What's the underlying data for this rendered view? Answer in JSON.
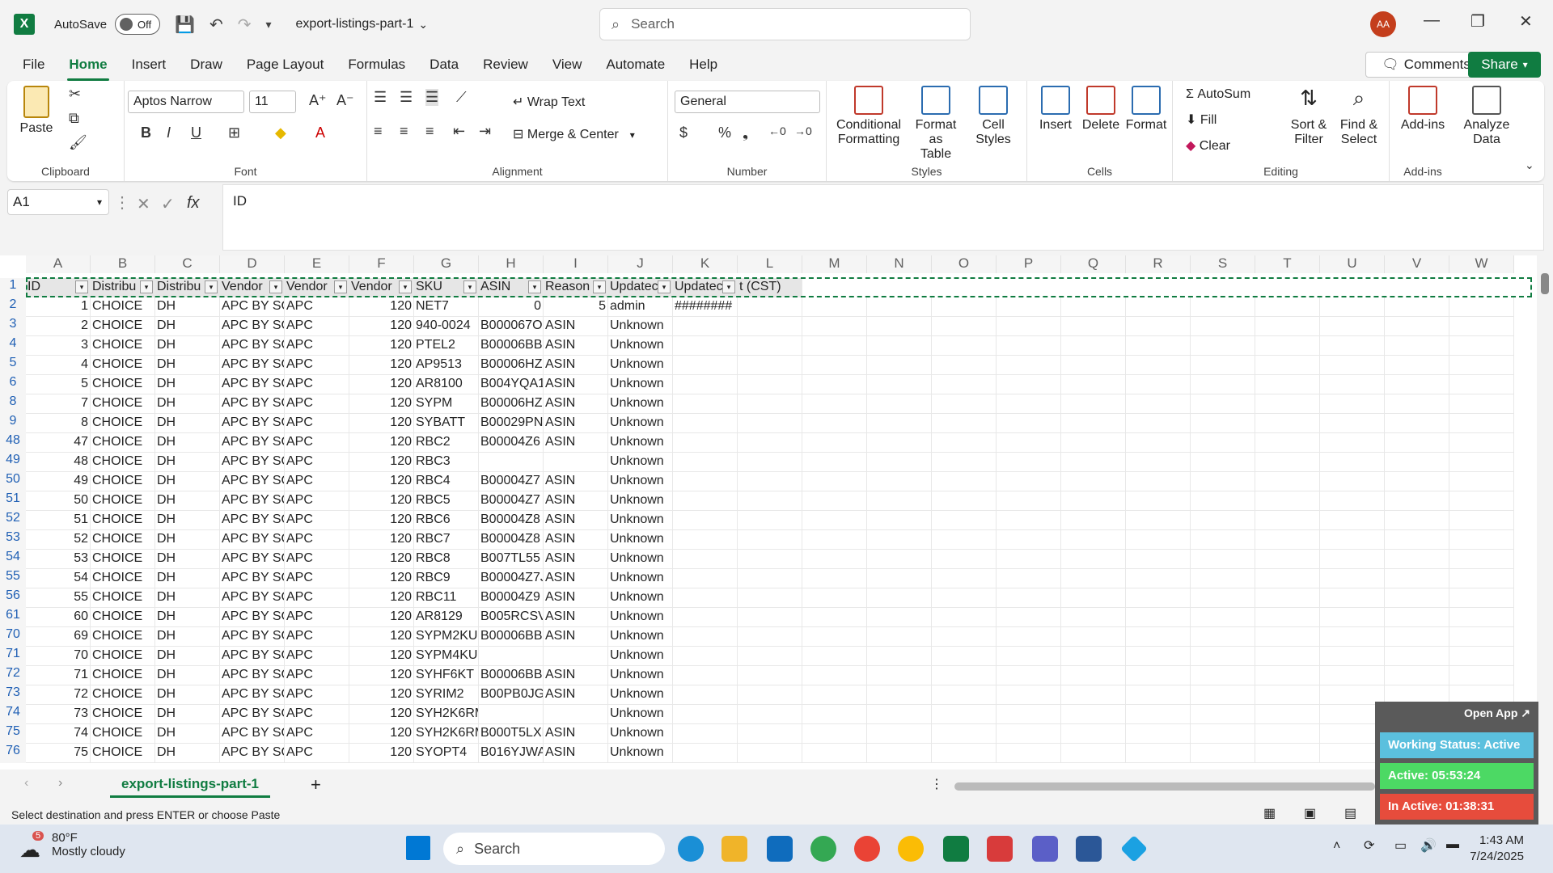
{
  "titlebar": {
    "app_logo": "X",
    "autosave_label": "AutoSave",
    "autosave_state": "Off",
    "doc_title": "export-listings-part-1",
    "search_placeholder": "Search",
    "avatar_initials": "AA"
  },
  "menu": {
    "items": [
      "File",
      "Home",
      "Insert",
      "Draw",
      "Page Layout",
      "Formulas",
      "Data",
      "Review",
      "View",
      "Automate",
      "Help"
    ],
    "active": "Home",
    "comments": "Comments",
    "share": "Share"
  },
  "ribbon": {
    "clipboard": {
      "label": "Clipboard",
      "paste": "Paste"
    },
    "font": {
      "label": "Font",
      "font_name": "Aptos Narrow",
      "font_size": "11"
    },
    "alignment": {
      "label": "Alignment",
      "wrap": "Wrap Text",
      "merge": "Merge & Center"
    },
    "number": {
      "label": "Number",
      "format": "General"
    },
    "styles": {
      "label": "Styles",
      "conditional": "Conditional",
      "conditional2": "Formatting",
      "format_table": "Format as",
      "format_table2": "Table",
      "cell_styles": "Cell",
      "cell_styles2": "Styles"
    },
    "cells": {
      "label": "Cells",
      "insert": "Insert",
      "delete": "Delete",
      "format": "Format"
    },
    "editing": {
      "label": "Editing",
      "autosum": "AutoSum",
      "fill": "Fill",
      "clear": "Clear",
      "sort": "Sort &",
      "sort2": "Filter",
      "find": "Find &",
      "find2": "Select"
    },
    "addins": {
      "label": "Add-ins",
      "addins": "Add-ins",
      "analyze": "Analyze",
      "analyze2": "Data"
    }
  },
  "formula_bar": {
    "namebox": "A1",
    "value": "ID"
  },
  "grid": {
    "columns": [
      "A",
      "B",
      "C",
      "D",
      "E",
      "F",
      "G",
      "H",
      "I",
      "J",
      "K",
      "L",
      "M",
      "N",
      "O",
      "P",
      "Q",
      "R",
      "S",
      "T",
      "U",
      "V",
      "W"
    ],
    "header_row": [
      "ID",
      "Distribu",
      "Distribu",
      "Vendor",
      "Vendor",
      "Vendor",
      "SKU",
      "ASIN",
      "Reason",
      "Updatec",
      "Updatec",
      "t (CST)"
    ],
    "rows": [
      {
        "n": "2",
        "c": [
          "1",
          "CHOICE",
          "DH",
          "APC BY SC",
          "APC",
          "120",
          "NET7",
          "0",
          "5",
          "admin",
          "########"
        ]
      },
      {
        "n": "3",
        "c": [
          "2",
          "CHOICE",
          "DH",
          "APC BY SC",
          "APC",
          "120",
          "940-0024",
          "B000067O",
          "ASIN",
          "Unknown",
          ""
        ]
      },
      {
        "n": "4",
        "c": [
          "3",
          "CHOICE",
          "DH",
          "APC BY SC",
          "APC",
          "120",
          "PTEL2",
          "B00006BB",
          "ASIN",
          "Unknown",
          ""
        ]
      },
      {
        "n": "5",
        "c": [
          "4",
          "CHOICE",
          "DH",
          "APC BY SC",
          "APC",
          "120",
          "AP9513",
          "B00006HZ",
          "ASIN",
          "Unknown",
          ""
        ]
      },
      {
        "n": "6",
        "c": [
          "5",
          "CHOICE",
          "DH",
          "APC BY SC",
          "APC",
          "120",
          "AR8100",
          "B004YQA1",
          "ASIN",
          "Unknown",
          ""
        ]
      },
      {
        "n": "8",
        "c": [
          "7",
          "CHOICE",
          "DH",
          "APC BY SC",
          "APC",
          "120",
          "SYPM",
          "B00006HZ",
          "ASIN",
          "Unknown",
          ""
        ]
      },
      {
        "n": "9",
        "c": [
          "8",
          "CHOICE",
          "DH",
          "APC BY SC",
          "APC",
          "120",
          "SYBATT",
          "B00029PN",
          "ASIN",
          "Unknown",
          ""
        ]
      },
      {
        "n": "48",
        "c": [
          "47",
          "CHOICE",
          "DH",
          "APC BY SC",
          "APC",
          "120",
          "RBC2",
          "B00004Z6",
          "ASIN",
          "Unknown",
          ""
        ]
      },
      {
        "n": "49",
        "c": [
          "48",
          "CHOICE",
          "DH",
          "APC BY SC",
          "APC",
          "120",
          "RBC3",
          "",
          "",
          "Unknown",
          ""
        ]
      },
      {
        "n": "50",
        "c": [
          "49",
          "CHOICE",
          "DH",
          "APC BY SC",
          "APC",
          "120",
          "RBC4",
          "B00004Z7",
          "ASIN",
          "Unknown",
          ""
        ]
      },
      {
        "n": "51",
        "c": [
          "50",
          "CHOICE",
          "DH",
          "APC BY SC",
          "APC",
          "120",
          "RBC5",
          "B00004Z7",
          "ASIN",
          "Unknown",
          ""
        ]
      },
      {
        "n": "52",
        "c": [
          "51",
          "CHOICE",
          "DH",
          "APC BY SC",
          "APC",
          "120",
          "RBC6",
          "B00004Z8",
          "ASIN",
          "Unknown",
          ""
        ]
      },
      {
        "n": "53",
        "c": [
          "52",
          "CHOICE",
          "DH",
          "APC BY SC",
          "APC",
          "120",
          "RBC7",
          "B00004Z8",
          "ASIN",
          "Unknown",
          ""
        ]
      },
      {
        "n": "54",
        "c": [
          "53",
          "CHOICE",
          "DH",
          "APC BY SC",
          "APC",
          "120",
          "RBC8",
          "B007TL55",
          "ASIN",
          "Unknown",
          ""
        ]
      },
      {
        "n": "55",
        "c": [
          "54",
          "CHOICE",
          "DH",
          "APC BY SC",
          "APC",
          "120",
          "RBC9",
          "B00004Z7J",
          "ASIN",
          "Unknown",
          ""
        ]
      },
      {
        "n": "56",
        "c": [
          "55",
          "CHOICE",
          "DH",
          "APC BY SC",
          "APC",
          "120",
          "RBC11",
          "B00004Z9",
          "ASIN",
          "Unknown",
          ""
        ]
      },
      {
        "n": "61",
        "c": [
          "60",
          "CHOICE",
          "DH",
          "APC BY SC",
          "APC",
          "120",
          "AR8129",
          "B005RCSV",
          "ASIN",
          "Unknown",
          ""
        ]
      },
      {
        "n": "70",
        "c": [
          "69",
          "CHOICE",
          "DH",
          "APC BY SC",
          "APC",
          "120",
          "SYPM2KU",
          "B00006BB",
          "ASIN",
          "Unknown",
          ""
        ]
      },
      {
        "n": "71",
        "c": [
          "70",
          "CHOICE",
          "DH",
          "APC BY SC",
          "APC",
          "120",
          "SYPM4KU",
          "",
          "",
          "Unknown",
          ""
        ]
      },
      {
        "n": "72",
        "c": [
          "71",
          "CHOICE",
          "DH",
          "APC BY SC",
          "APC",
          "120",
          "SYHF6KT",
          "B00006BB",
          "ASIN",
          "Unknown",
          ""
        ]
      },
      {
        "n": "73",
        "c": [
          "72",
          "CHOICE",
          "DH",
          "APC BY SC",
          "APC",
          "120",
          "SYRIM2",
          "B00PB0JG",
          "ASIN",
          "Unknown",
          ""
        ]
      },
      {
        "n": "74",
        "c": [
          "73",
          "CHOICE",
          "DH",
          "APC BY SC",
          "APC",
          "120",
          "SYH2K6RMT",
          "",
          "",
          "Unknown",
          ""
        ]
      },
      {
        "n": "75",
        "c": [
          "74",
          "CHOICE",
          "DH",
          "APC BY SC",
          "APC",
          "120",
          "SYH2K6RM",
          "B000T5LXF",
          "ASIN",
          "Unknown",
          ""
        ]
      },
      {
        "n": "76",
        "c": [
          "75",
          "CHOICE",
          "DH",
          "APC BY SC",
          "APC",
          "120",
          "SYOPT4",
          "B016YJWA",
          "ASIN",
          "Unknown",
          ""
        ]
      }
    ]
  },
  "sheet_tab": "export-listings-part-1",
  "status": "Select destination and press ENTER or choose Paste",
  "tracker": {
    "open_app": "Open App ↗",
    "working": "Working Status: Active",
    "active": "Active: 05:53:24",
    "inactive": "In Active: 01:38:31",
    "color_working": "#5bc0de",
    "color_active": "#4cd964",
    "color_inactive": "#e74c3c"
  },
  "taskbar": {
    "temp": "80°F",
    "weather": "Mostly cloudy",
    "weather_badge": "5",
    "search": "Search",
    "time": "1:43 AM",
    "date": "7/24/2025"
  }
}
